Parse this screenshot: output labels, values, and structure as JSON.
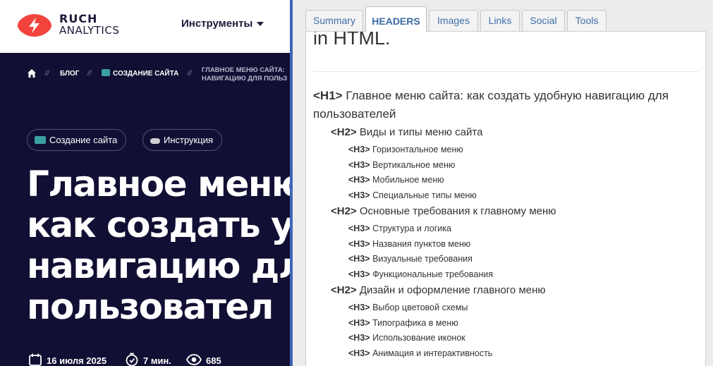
{
  "site": {
    "logo": {
      "line1": "RUСH",
      "line2": "ANALYTICS"
    },
    "nav_tools": "Инструменты",
    "breadcrumb": {
      "blog": "БЛОГ",
      "category": "СОЗДАНИЕ САЙТА",
      "current_line1": "ГЛАВНОЕ МЕНЮ САЙТА:",
      "current_line2": "НАВИГАЦИЮ ДЛЯ ПОЛЬЗ",
      "separator": "//"
    },
    "tags": [
      "Создание сайта",
      "Инструкция"
    ],
    "title_lines": [
      "Главное меню",
      "как создать у",
      "навигацию дл",
      "пользовател"
    ],
    "meta": {
      "date": "16 июля 2025",
      "read_time": "7 мин.",
      "views": "685"
    }
  },
  "panel": {
    "tabs": [
      "Summary",
      "HEADERS",
      "Images",
      "Links",
      "Social",
      "Tools"
    ],
    "active_tab": "HEADERS",
    "intro_text": "in HTML.",
    "headings": [
      {
        "level": "H1",
        "tag": "<H1>",
        "text": "Главное меню сайта: как создать удобную навигацию для пользователей"
      },
      {
        "level": "H2",
        "tag": "<H2>",
        "text": "Виды и типы меню сайта"
      },
      {
        "level": "H3",
        "tag": "<H3>",
        "text": "Горизонтальное меню"
      },
      {
        "level": "H3",
        "tag": "<H3>",
        "text": "Вертикальное меню"
      },
      {
        "level": "H3",
        "tag": "<H3>",
        "text": "Мобильное меню"
      },
      {
        "level": "H3",
        "tag": "<H3>",
        "text": "Специальные типы меню"
      },
      {
        "level": "H2",
        "tag": "<H2>",
        "text": "Основные требования к главному меню"
      },
      {
        "level": "H3",
        "tag": "<H3>",
        "text": "Структура и логика"
      },
      {
        "level": "H3",
        "tag": "<H3>",
        "text": "Названия пунктов меню"
      },
      {
        "level": "H3",
        "tag": "<H3>",
        "text": "Визуальные требования"
      },
      {
        "level": "H3",
        "tag": "<H3>",
        "text": "Функциональные требования"
      },
      {
        "level": "H2",
        "tag": "<H2>",
        "text": "Дизайн и оформление главного меню"
      },
      {
        "level": "H3",
        "tag": "<H3>",
        "text": "Выбор цветовой схемы"
      },
      {
        "level": "H3",
        "tag": "<H3>",
        "text": "Типографика в меню"
      },
      {
        "level": "H3",
        "tag": "<H3>",
        "text": "Использование иконок"
      },
      {
        "level": "H3",
        "tag": "<H3>",
        "text": "Анимация и интерактивность"
      }
    ]
  },
  "colors": {
    "site_bg": "#110f33",
    "logo_red": "#f2443d",
    "panel_bg": "#ececec",
    "tab_text": "#3f6fa8",
    "divider": "#3f65b7"
  },
  "icons": [
    "lightning-logo-icon",
    "home-icon",
    "caret-down-icon",
    "calendar-icon",
    "timer-icon",
    "eye-icon"
  ]
}
